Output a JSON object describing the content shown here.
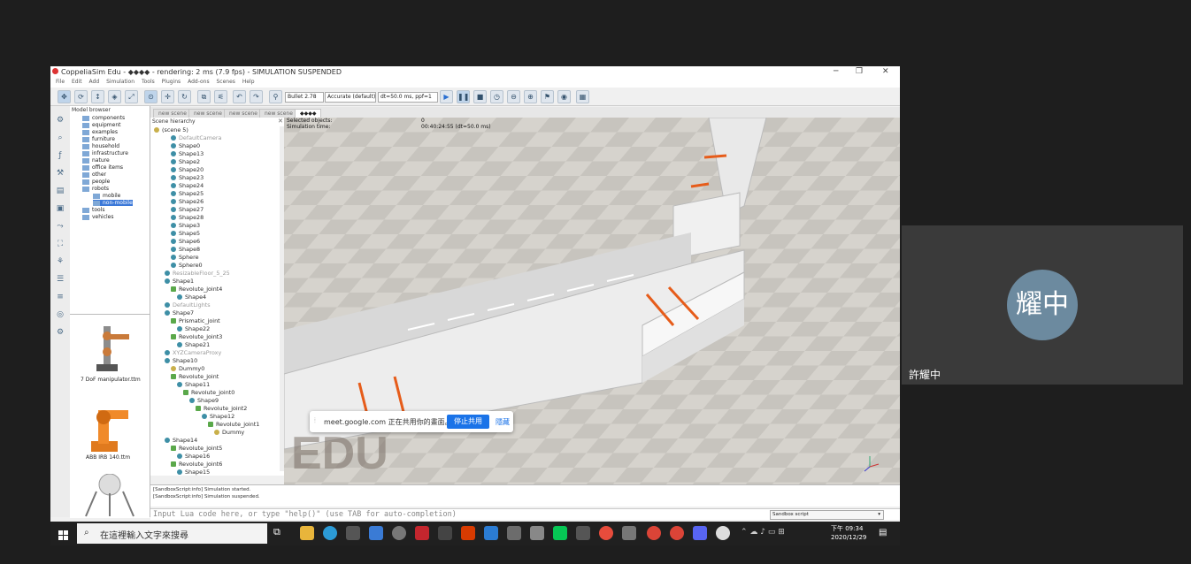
{
  "window": {
    "title": "CoppeliaSim Edu - ◆◆◆◆ - rendering: 2 ms (7.9 fps) - SIMULATION SUSPENDED",
    "controls": [
      "─",
      "❐",
      "✕"
    ]
  },
  "menu": [
    "File",
    "Edit",
    "Add",
    "Simulation",
    "Tools",
    "Plugins",
    "Add-ons",
    "Scenes",
    "Help"
  ],
  "toolbar": {
    "engine": "Bullet 2.78",
    "accuracy": "Accurate (default)",
    "timestep": "dt=50.0 ms, ppf=1"
  },
  "model_browser": {
    "header": "Model browser",
    "items": [
      "components",
      "equipment",
      "examples",
      "furniture",
      "household",
      "infrastructure",
      "nature",
      "office items",
      "other",
      "people",
      "robots",
      "mobile",
      "non-mobile",
      "tools",
      "vehicles"
    ],
    "selected": "non-mobile",
    "thumbnails": [
      "7 DoF manipulator.ttm",
      "ABB IRB 140.ttm"
    ]
  },
  "scene_tabs": [
    "new scene",
    "new scene",
    "new scene",
    "new scene",
    "◆◆◆◆"
  ],
  "hierarchy": {
    "header": "Scene hierarchy",
    "root": "(scene 5)",
    "items": [
      {
        "label": "DefaultCamera",
        "grey": true,
        "indent": 1
      },
      {
        "label": "Shape0",
        "indent": 1
      },
      {
        "label": "Shape13",
        "indent": 1
      },
      {
        "label": "Shape2",
        "indent": 1
      },
      {
        "label": "Shape20",
        "indent": 1
      },
      {
        "label": "Shape23",
        "indent": 1
      },
      {
        "label": "Shape24",
        "indent": 1
      },
      {
        "label": "Shape25",
        "indent": 1
      },
      {
        "label": "Shape26",
        "indent": 1
      },
      {
        "label": "Shape27",
        "indent": 1
      },
      {
        "label": "Shape28",
        "indent": 1
      },
      {
        "label": "Shape3",
        "indent": 1
      },
      {
        "label": "Shape5",
        "indent": 1
      },
      {
        "label": "Shape6",
        "indent": 1
      },
      {
        "label": "Shape8",
        "indent": 1
      },
      {
        "label": "Sphere",
        "indent": 1
      },
      {
        "label": "Sphere0",
        "indent": 1
      },
      {
        "label": "ResizableFloor_5_25",
        "grey": true,
        "indent": 0
      },
      {
        "label": "Shape1",
        "indent": 0
      },
      {
        "label": "Revolute_joint4",
        "indent": 1,
        "joint": true
      },
      {
        "label": "Shape4",
        "indent": 2
      },
      {
        "label": "DefaultLights",
        "grey": true,
        "indent": 0
      },
      {
        "label": "Shape7",
        "indent": 0
      },
      {
        "label": "Prismatic_joint",
        "indent": 1,
        "joint": true
      },
      {
        "label": "Shape22",
        "indent": 2
      },
      {
        "label": "Revolute_joint3",
        "indent": 1,
        "joint": true
      },
      {
        "label": "Shape21",
        "indent": 2
      },
      {
        "label": "XYZCameraProxy",
        "grey": true,
        "indent": 0
      },
      {
        "label": "Shape10",
        "indent": 0
      },
      {
        "label": "Dummy0",
        "indent": 1,
        "cam": true
      },
      {
        "label": "Revolute_joint",
        "indent": 1,
        "joint": true
      },
      {
        "label": "Shape11",
        "indent": 2
      },
      {
        "label": "Revolute_joint0",
        "indent": 3,
        "joint": true
      },
      {
        "label": "Shape9",
        "indent": 4
      },
      {
        "label": "Revolute_joint2",
        "indent": 5,
        "joint": true
      },
      {
        "label": "Shape12",
        "indent": 6
      },
      {
        "label": "Revolute_joint1",
        "indent": 7,
        "joint": true
      },
      {
        "label": "Dummy",
        "indent": 8,
        "cam": true
      },
      {
        "label": "Shape14",
        "indent": 0
      },
      {
        "label": "Revolute_joint5",
        "indent": 1,
        "joint": true
      },
      {
        "label": "Shape16",
        "indent": 2
      },
      {
        "label": "Revolute_joint6",
        "indent": 1,
        "joint": true
      },
      {
        "label": "Shape15",
        "indent": 2
      }
    ]
  },
  "viewport": {
    "selected_label": "Selected objects:",
    "selected_value": "0",
    "time_label": "Simulation time:",
    "time_value": "00:40:24:55 (dt=50.0 ms)",
    "watermark": "EDU"
  },
  "screen_share": {
    "text": "meet.google.com 正在共用你的畫面。",
    "stop": "停止共用",
    "hide": "隱藏"
  },
  "status_log": [
    "[SandboxScript:info] Simulation started.",
    "[SandboxScript:info] Simulation suspended."
  ],
  "lua": {
    "placeholder": "Input Lua code here, or type \"help()\" (use TAB for auto-completion)",
    "script": "Sandbox script"
  },
  "taskbar": {
    "search": "在這裡輸入文字來搜尋",
    "time": "下午 09:34",
    "date": "2020/12/29"
  },
  "participant": {
    "avatar": "耀中",
    "name": "許耀中"
  }
}
